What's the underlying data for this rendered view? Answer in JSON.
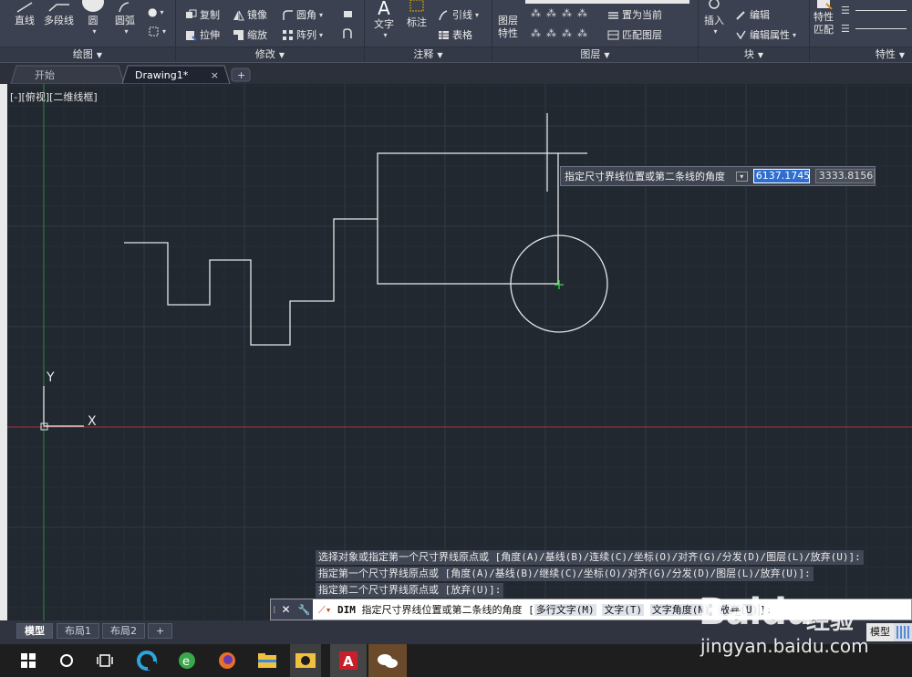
{
  "ribbon": {
    "draw": {
      "line": "直线",
      "polyline": "多段线",
      "circle": "圆",
      "arc": "圆弧",
      "title": "绘图"
    },
    "modify": {
      "move": "复制",
      "mirror": "镜像",
      "fillet": "圆角",
      "stretch": "拉伸",
      "scale": "缩放",
      "array": "阵列",
      "title": "修改"
    },
    "annotation": {
      "text": "文字",
      "dimension": "标注",
      "leader": "引线",
      "table": "表格",
      "title": "注释"
    },
    "layers": {
      "layer_props_l1": "图层",
      "layer_props_l2": "特性",
      "set_current": "置为当前",
      "match_layer": "匹配图层",
      "title": "图层"
    },
    "block": {
      "insert": "插入",
      "edit": "编辑",
      "edit_attr": "编辑属性",
      "title": "块"
    },
    "properties": {
      "match_l1": "特性",
      "match_l2": "匹配",
      "title": "特性"
    }
  },
  "tabs": {
    "start": "开始",
    "drawing": "Drawing1*",
    "close": "×",
    "add": "+"
  },
  "viewport": {
    "label": "[-][俯视][二维线框]"
  },
  "ucs": {
    "x": "X",
    "y": "Y"
  },
  "dyn_input": {
    "prompt": "指定尺寸界线位置或第二条线的角度",
    "value1": "6137.1745",
    "value2": "3333.8156"
  },
  "command_history": [
    "选择对象或指定第一个尺寸界线原点或 [角度(A)/基线(B)/连续(C)/坐标(O)/对齐(G)/分发(D)/图层(L)/放弃(U)]:",
    "指定第一个尺寸界线原点或 [角度(A)/基线(B)/继续(C)/坐标(O)/对齐(G)/分发(D)/图层(L)/放弃(U)]:",
    "指定第二个尺寸界线原点或 [放弃(U)]:"
  ],
  "command_line": {
    "cmd": "DIM",
    "prompt": "指定尺寸界线位置或第二条线的角度",
    "opt1": "多行文字(M)",
    "opt2": "文字(T)",
    "opt3": "文字角度(N)",
    "opt4": "放弃(U)",
    "tail": "]:"
  },
  "layout_tabs": {
    "model": "模型",
    "layout1": "布局1",
    "layout2": "布局2",
    "add": "+"
  },
  "status": {
    "model": "模型"
  },
  "watermark": {
    "brand": "Baidu",
    "sub": "经验",
    "url": "jingyan.baidu.com"
  },
  "colors": {
    "canvas": "#212830",
    "ribbon": "#3b4150",
    "x_axis": "#a8303a",
    "y_axis": "#2f8a3a",
    "highlight": "#2d6ed0"
  },
  "icons": [
    "line-icon",
    "polyline-icon",
    "circle-icon",
    "arc-icon",
    "copy-icon",
    "mirror-icon",
    "fillet-icon",
    "stretch-icon",
    "scale-icon",
    "array-icon",
    "text-icon",
    "dimension-icon",
    "leader-icon",
    "table-icon",
    "layer-icon",
    "insert-icon",
    "edit-icon",
    "match-properties-icon",
    "windows-start-icon",
    "search-icon",
    "taskview-icon",
    "browser-icon",
    "ie-icon",
    "firefox-icon",
    "folder-icon",
    "media-icon",
    "autocad-icon",
    "wechat-icon"
  ]
}
